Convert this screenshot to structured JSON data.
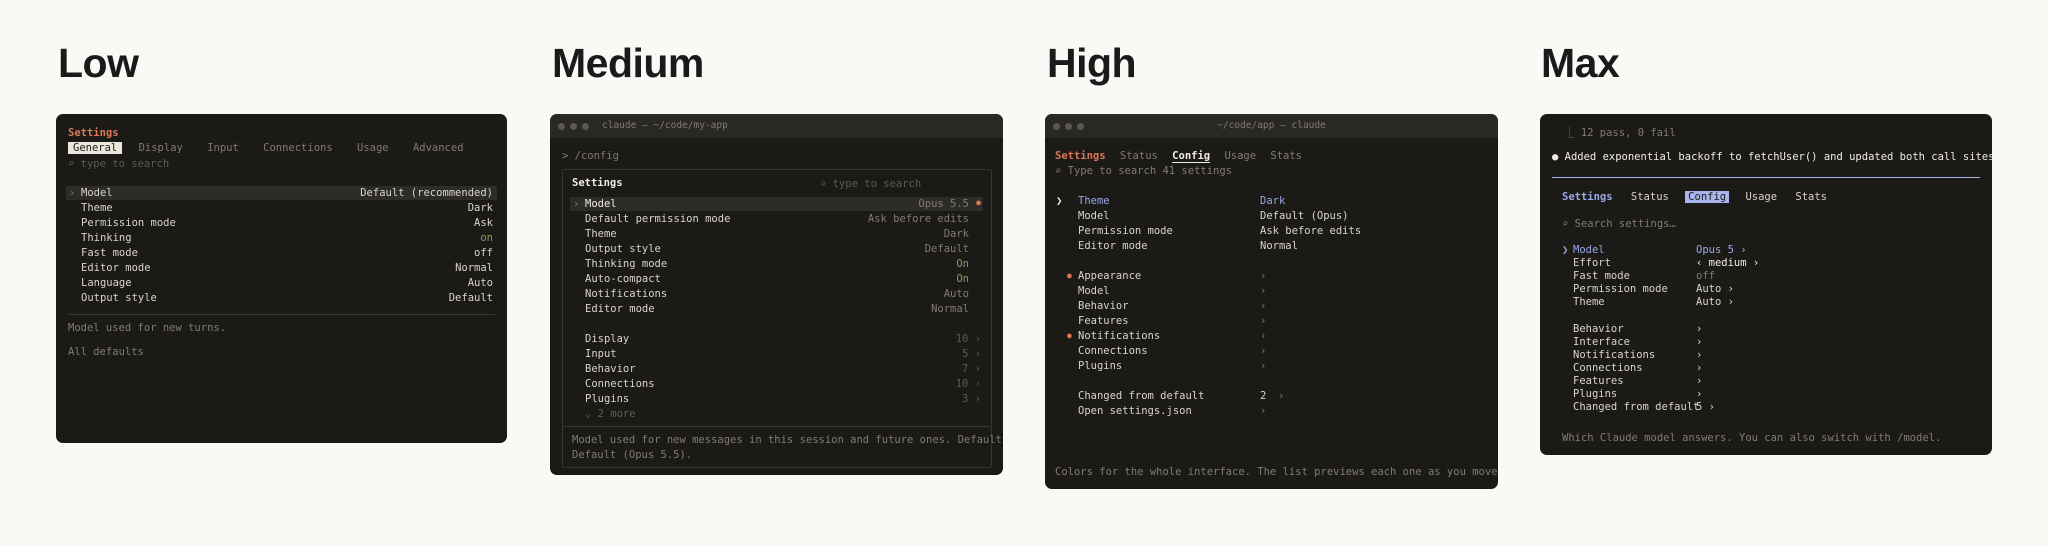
{
  "headings": {
    "low": "Low",
    "medium": "Medium",
    "high": "High",
    "max": "Max"
  },
  "low": {
    "title": "Settings",
    "tabs": [
      "General",
      "Display",
      "Input",
      "Connections",
      "Usage",
      "Advanced"
    ],
    "search_placeholder": "⌕ type to search",
    "rows": [
      {
        "label": "Model",
        "value": "Default (recommended)"
      },
      {
        "label": "Theme",
        "value": "Dark"
      },
      {
        "label": "Permission mode",
        "value": "Ask"
      },
      {
        "label": "Thinking",
        "value": "on"
      },
      {
        "label": "Fast mode",
        "value": "off"
      },
      {
        "label": "Editor mode",
        "value": "Normal"
      },
      {
        "label": "Language",
        "value": "Auto"
      },
      {
        "label": "Output style",
        "value": "Default"
      }
    ],
    "caret": "›",
    "description": "Model used for new turns.",
    "footer": "All defaults"
  },
  "medium": {
    "window_title": "claude — ~/code/my-app",
    "prompt": "> /config",
    "title": "Settings",
    "search_placeholder": "⌕ type to search",
    "rows": [
      {
        "label": "Model",
        "value": "Opus 5.5"
      },
      {
        "label": "Default permission mode",
        "value": "Ask before edits"
      },
      {
        "label": "Theme",
        "value": "Dark"
      },
      {
        "label": "Output style",
        "value": "Default"
      },
      {
        "label": "Thinking mode",
        "value": "On"
      },
      {
        "label": "Auto-compact",
        "value": "On"
      },
      {
        "label": "Notifications",
        "value": "Auto"
      },
      {
        "label": "Editor mode",
        "value": "Normal"
      }
    ],
    "groups": [
      {
        "label": "Display",
        "count": "10 ›"
      },
      {
        "label": "Input",
        "count": "5 ›"
      },
      {
        "label": "Behavior",
        "count": "7 ›"
      },
      {
        "label": "Connections",
        "count": "10 ›"
      },
      {
        "label": "Plugins",
        "count": "3 ›"
      }
    ],
    "more": "⌄ 2 more",
    "modified_dot": "●",
    "caret": "›",
    "description_1": "Model used for new messages in this session and future ones. Default:",
    "description_2": "Default (Opus 5.5)."
  },
  "high": {
    "window_title": "~/code/app — claude",
    "tabs": [
      "Settings",
      "Status",
      "Config",
      "Usage",
      "Stats"
    ],
    "search_hint": "⌕ Type to search 41 settings",
    "rows": [
      {
        "label": "Theme",
        "value": "Dark"
      },
      {
        "label": "Model",
        "value": "Default (Opus)"
      },
      {
        "label": "Permission mode",
        "value": "Ask before edits"
      },
      {
        "label": "Editor mode",
        "value": "Normal"
      }
    ],
    "cursor": "❯",
    "groups": [
      {
        "label": "Appearance",
        "arrow": "›",
        "dot": "●"
      },
      {
        "label": "Model",
        "arrow": "›",
        "dot": ""
      },
      {
        "label": "Behavior",
        "arrow": "›",
        "dot": ""
      },
      {
        "label": "Features",
        "arrow": "›",
        "dot": ""
      },
      {
        "label": "Notifications",
        "arrow": "›",
        "dot": "●"
      },
      {
        "label": "Connections",
        "arrow": "›",
        "dot": ""
      },
      {
        "label": "Plugins",
        "arrow": "›",
        "dot": ""
      }
    ],
    "changed_label": "Changed from default",
    "changed_count": "2",
    "changed_arrow": "›",
    "open_json": "Open settings.json",
    "open_arrow": "›",
    "footer": "Colors for the whole interface. The list previews each one as you move."
  },
  "max": {
    "test_result": "⎿ 12 pass, 0 fail",
    "message": "● Added exponential backoff to fetchUser() and updated both call sites.",
    "tabs": [
      "Settings",
      "Status",
      "Config",
      "Usage",
      "Stats"
    ],
    "search_placeholder": "⌕ Search settings…",
    "rows": [
      {
        "label": "Model",
        "value": "Opus 5 ›"
      },
      {
        "label": "Effort",
        "value": "‹ medium ›"
      },
      {
        "label": "Fast mode",
        "value": "off"
      },
      {
        "label": "Permission mode",
        "value": "Auto ›"
      },
      {
        "label": "Theme",
        "value": "Auto ›"
      }
    ],
    "caret": "❯",
    "groups": [
      {
        "label": "Behavior",
        "value": "›"
      },
      {
        "label": "Interface",
        "value": "›"
      },
      {
        "label": "Notifications",
        "value": "›"
      },
      {
        "label": "Connections",
        "value": "›"
      },
      {
        "label": "Features",
        "value": "›"
      },
      {
        "label": "Plugins",
        "value": "›"
      },
      {
        "label": "Changed from default",
        "value": "5 ›"
      }
    ],
    "footer": "Which Claude model answers. You can also switch with /model."
  }
}
